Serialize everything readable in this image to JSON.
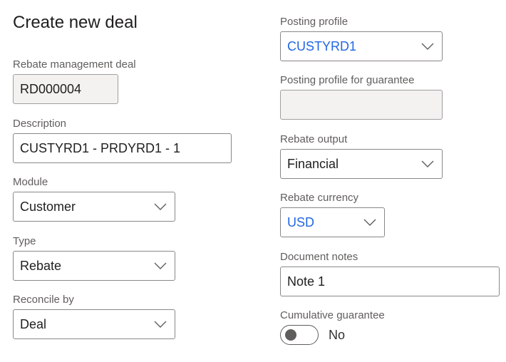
{
  "page": {
    "title": "Create new deal"
  },
  "left": {
    "rebate_deal": {
      "label": "Rebate management deal",
      "value": "RD000004"
    },
    "description": {
      "label": "Description",
      "value": "CUSTYRD1 - PRDYRD1 - 1"
    },
    "module": {
      "label": "Module",
      "value": "Customer"
    },
    "type": {
      "label": "Type",
      "value": "Rebate"
    },
    "reconcile_by": {
      "label": "Reconcile by",
      "value": "Deal"
    }
  },
  "right": {
    "posting_profile": {
      "label": "Posting profile",
      "value": "CUSTYRD1"
    },
    "posting_profile_guarantee": {
      "label": "Posting profile for guarantee",
      "value": ""
    },
    "rebate_output": {
      "label": "Rebate output",
      "value": "Financial"
    },
    "rebate_currency": {
      "label": "Rebate currency",
      "value": "USD"
    },
    "document_notes": {
      "label": "Document notes",
      "value": "Note 1"
    },
    "cumulative_guarantee": {
      "label": "Cumulative guarantee",
      "state": "No",
      "on": false
    }
  },
  "colors": {
    "link": "#2266e3",
    "label": "#605e5c",
    "readonly_bg": "#f3f2f1"
  }
}
